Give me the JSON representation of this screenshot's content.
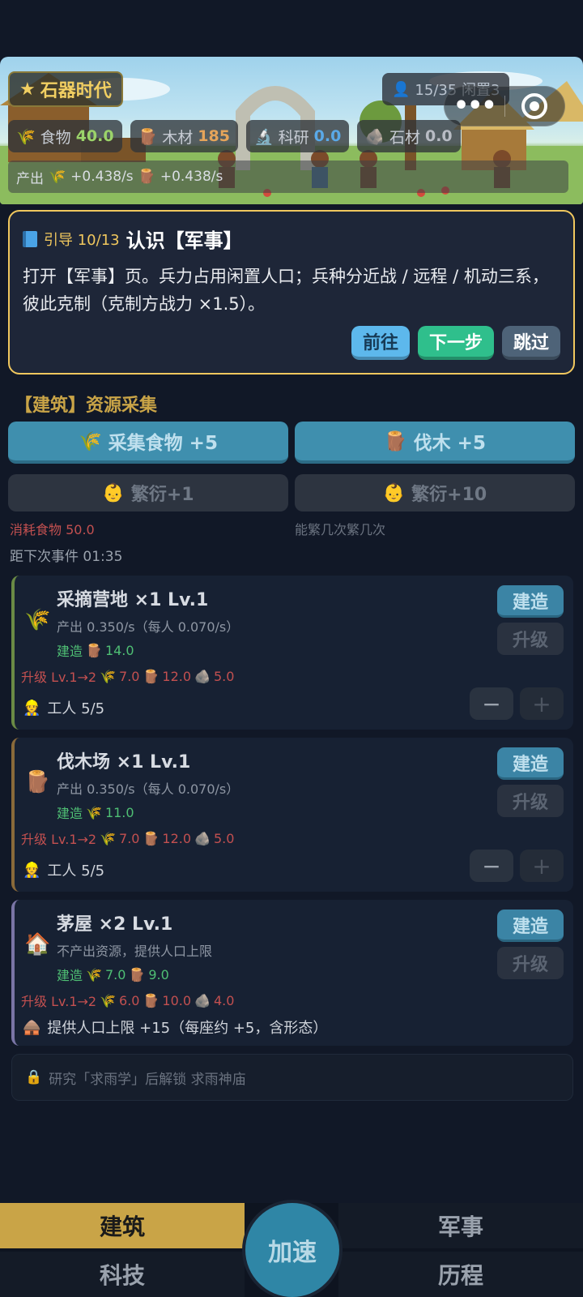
{
  "header": {
    "era": "石器时代",
    "population": "15/35 闲置3",
    "resources": [
      {
        "label": "食物",
        "value": "40.0",
        "icon": "wheat-icon"
      },
      {
        "label": "木材",
        "value": "185",
        "icon": "log-icon"
      },
      {
        "label": "科研",
        "value": "0.0",
        "icon": "microscope-icon"
      },
      {
        "label": "石材",
        "value": "0.0",
        "icon": "stone-icon"
      }
    ],
    "production": {
      "label": "产出",
      "food_rate": "+0.438/s",
      "wood_rate": "+0.438/s"
    }
  },
  "guide": {
    "step": "引导 10/13",
    "title": "认识【军事】",
    "text": "打开【军事】页。兵力占用闲置人口；兵种分近战 / 远程 / 机动三系，彼此克制（克制方战力 ×1.5）。",
    "go": "前往",
    "next": "下一步",
    "skip": "跳过"
  },
  "section": {
    "title": "【建筑】资源采集",
    "gather_food": "采集食物 +5",
    "chop_wood": "伐木 +5",
    "breed1": "繁衍+1",
    "breed10": "繁衍+10",
    "breed_cost": "消耗食物 50.0",
    "breed_note": "能繁几次繁几次",
    "next_event": "距下次事件 01:35"
  },
  "buildings": [
    {
      "name": "采摘营地 ×1  Lv.1",
      "desc": "产出 0.350/s（每人 0.070/s）",
      "cost_label": "建造",
      "cost": "14.0",
      "upgrade_label": "升级 Lv.1→2",
      "up_food": "7.0",
      "up_wood": "12.0",
      "up_stone": "5.0",
      "workers": "工人 5/5",
      "build": "建造",
      "upgrade": "升级"
    },
    {
      "name": "伐木场 ×1  Lv.1",
      "desc": "产出 0.350/s（每人 0.070/s）",
      "cost_label": "建造",
      "cost": "11.0",
      "upgrade_label": "升级 Lv.1→2",
      "up_food": "7.0",
      "up_wood": "12.0",
      "up_stone": "5.0",
      "workers": "工人 5/5",
      "build": "建造",
      "upgrade": "升级"
    },
    {
      "name": "茅屋 ×2  Lv.1",
      "desc": "不产出资源，提供人口上限",
      "cost_label": "建造",
      "cost_food": "7.0",
      "cost_wood": "9.0",
      "upgrade_label": "升级 Lv.1→2",
      "up_food": "6.0",
      "up_wood": "10.0",
      "up_stone": "4.0",
      "provide": "提供人口上限 +15（每座约 +5，含形态）",
      "build": "建造",
      "upgrade": "升级"
    }
  ],
  "locked": "研究「求雨学」后解锁 求雨神庙",
  "nav": {
    "build": "建筑",
    "military": "军事",
    "tech": "科技",
    "history": "历程",
    "speed": "加速"
  },
  "colors": {
    "accent": "#c9a447",
    "primary_button": "#3f8fae",
    "guide_border": "#f0c75e",
    "background": "#111827"
  }
}
